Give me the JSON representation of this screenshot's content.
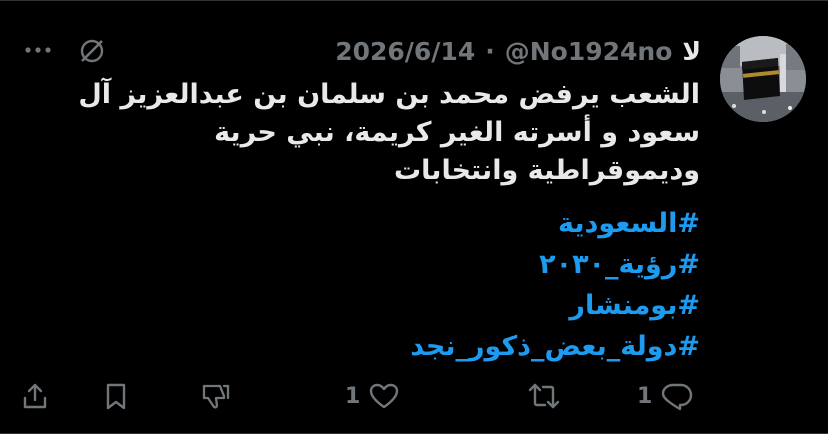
{
  "tweet": {
    "display_name": "لا",
    "handle": "@No1924no",
    "separator": "·",
    "date": "2026/6/14",
    "text_lines": [
      "الشعب يرفض محمد بن سلمان بن عبدالعزيز آل",
      "سعود و أسرته الغير كريمة، نبي حرية",
      "وديموقراطية وانتخابات"
    ],
    "hashtags": [
      "#السعودية",
      "#رؤية_٢٠٣٠",
      "#بومنشار",
      "#دولة_بعض_ذكور_نجد"
    ]
  },
  "actions": {
    "reply_count": "1",
    "retweet_count": "",
    "like_count": "1"
  },
  "colors": {
    "background": "#000000",
    "text": "#e7e9ea",
    "muted": "#71767b",
    "link": "#1d9bf0"
  },
  "icons": [
    "more-icon",
    "caret-icon",
    "share-icon",
    "bookmark-icon",
    "downvote-icon",
    "like-icon",
    "retweet-icon",
    "reply-icon"
  ]
}
